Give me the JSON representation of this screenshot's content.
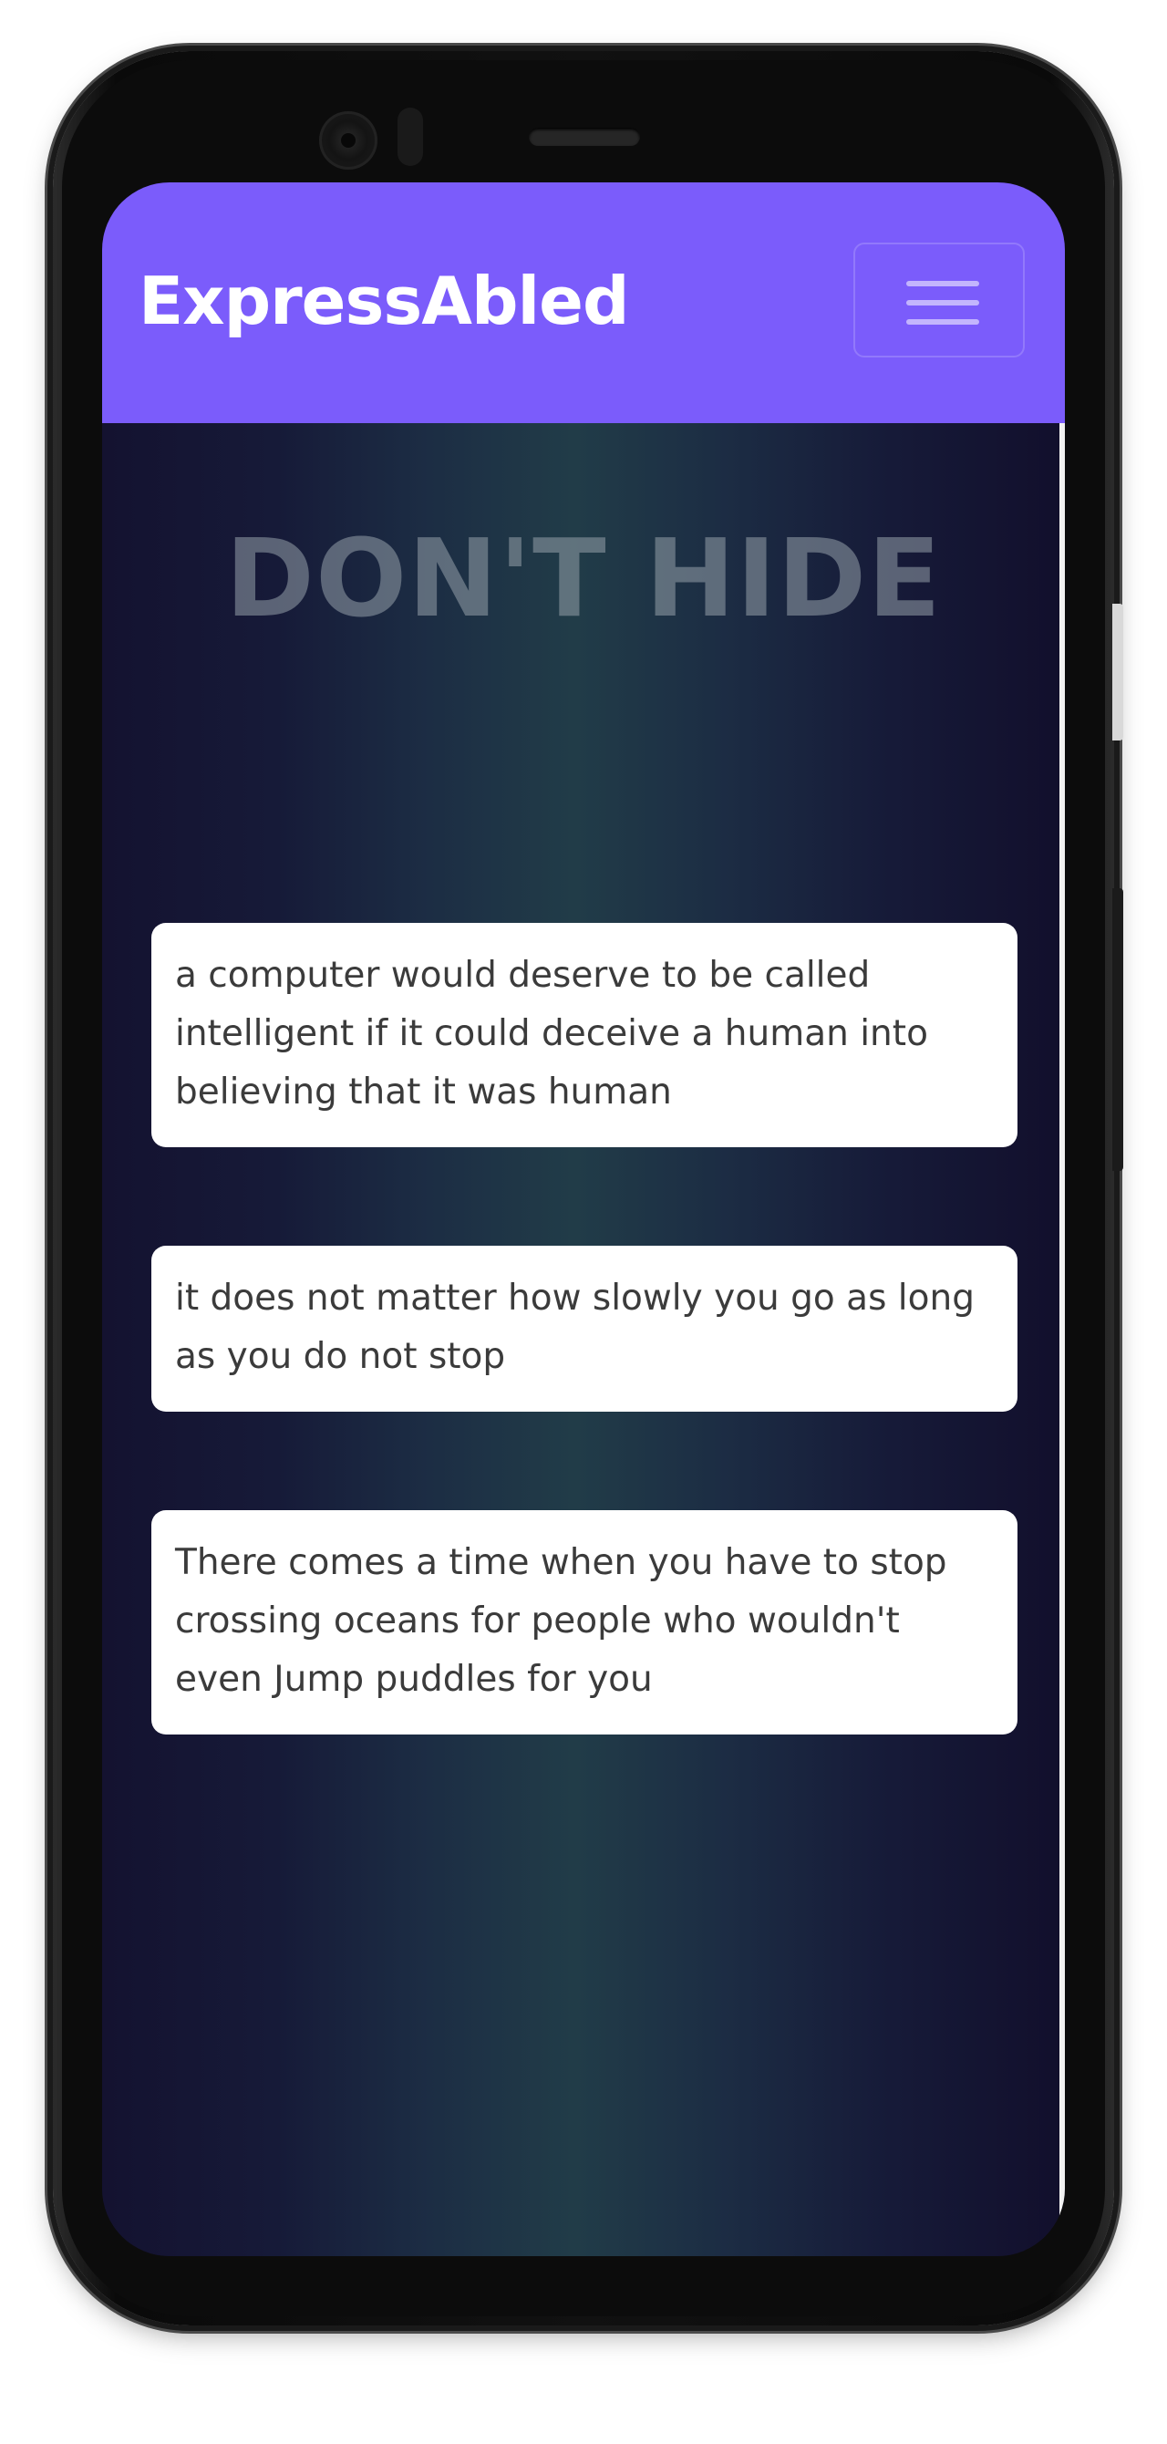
{
  "navbar": {
    "brand": "ExpressAbled",
    "menu_icon": "hamburger-menu-icon"
  },
  "hero": {
    "title": "DON'T HIDE"
  },
  "quotes": [
    {
      "text": "a computer would deserve to be called intelligent if it could deceive a human into believing that it was human"
    },
    {
      "text": "it does not matter how slowly you go as long as you do not stop"
    },
    {
      "text": "There comes a time when you have to stop crossing oceans for people who wouldn't even Jump puddles for you"
    }
  ],
  "colors": {
    "navbar": "#7b5cfb",
    "background_dark": "#141230",
    "background_teal": "#213c48",
    "card": "#ffffff",
    "hero_text": "#96a0aa"
  }
}
